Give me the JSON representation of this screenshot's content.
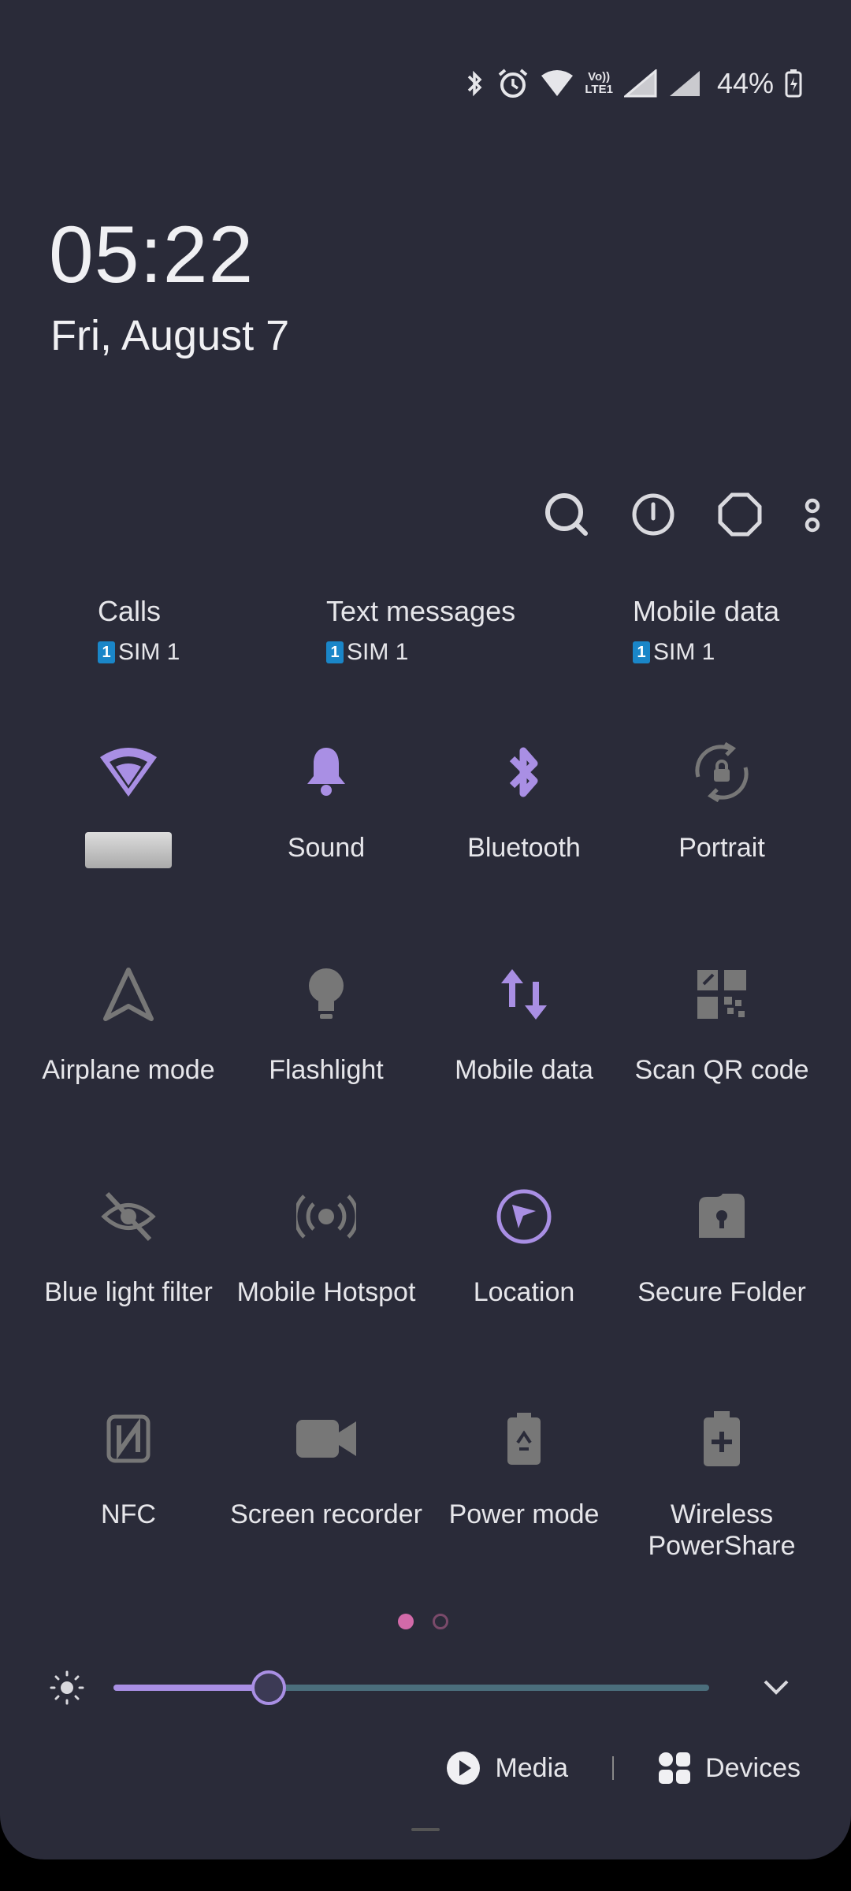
{
  "status_bar": {
    "battery": "44%",
    "icons": [
      "bluetooth-icon",
      "alarm-icon",
      "wifi-icon",
      "volte-icon",
      "signal-icon",
      "signal-icon",
      "battery-charging-icon"
    ],
    "volte_label": "Vo)) LTE1"
  },
  "clock": "05:22",
  "date": "Fri, August 7",
  "top_actions": [
    "search-icon",
    "power-icon",
    "settings-icon",
    "more-icon"
  ],
  "sim_info": [
    {
      "title": "Calls",
      "sim": "SIM 1",
      "badge": "1"
    },
    {
      "title": "Text messages",
      "sim": "SIM 1",
      "badge": "1"
    },
    {
      "title": "Mobile data",
      "sim": "SIM 1",
      "badge": "1"
    }
  ],
  "tiles": [
    {
      "label": "",
      "icon": "wifi-icon",
      "active": true
    },
    {
      "label": "Sound",
      "icon": "bell-icon",
      "active": true
    },
    {
      "label": "Bluetooth",
      "icon": "bluetooth-icon",
      "active": true
    },
    {
      "label": "Portrait",
      "icon": "rotation-lock-icon",
      "active": false
    },
    {
      "label": "Airplane mode",
      "icon": "airplane-icon",
      "active": false
    },
    {
      "label": "Flashlight",
      "icon": "flashlight-icon",
      "active": false
    },
    {
      "label": "Mobile data",
      "icon": "mobile-data-icon",
      "active": true
    },
    {
      "label": "Scan QR code",
      "icon": "qr-code-icon",
      "active": false
    },
    {
      "label": "Blue light filter",
      "icon": "eye-off-icon",
      "active": false
    },
    {
      "label": "Mobile Hotspot",
      "icon": "hotspot-icon",
      "active": false
    },
    {
      "label": "Location",
      "icon": "location-icon",
      "active": true
    },
    {
      "label": "Secure Folder",
      "icon": "secure-folder-icon",
      "active": false
    },
    {
      "label": "NFC",
      "icon": "nfc-icon",
      "active": false
    },
    {
      "label": "Screen recorder",
      "icon": "video-icon",
      "active": false
    },
    {
      "label": "Power mode",
      "icon": "battery-saver-icon",
      "active": false
    },
    {
      "label": "Wireless PowerShare",
      "icon": "wireless-powershare-icon",
      "active": false
    }
  ],
  "page_indicator": {
    "pages": 2,
    "current": 1
  },
  "brightness": {
    "level": 0.26
  },
  "bottom": {
    "media": "Media",
    "devices": "Devices"
  },
  "colors": {
    "accent": "#a98fe4",
    "inactive": "#8a8a92",
    "background": "#2a2b39",
    "page_dot": "#d26aa9"
  }
}
